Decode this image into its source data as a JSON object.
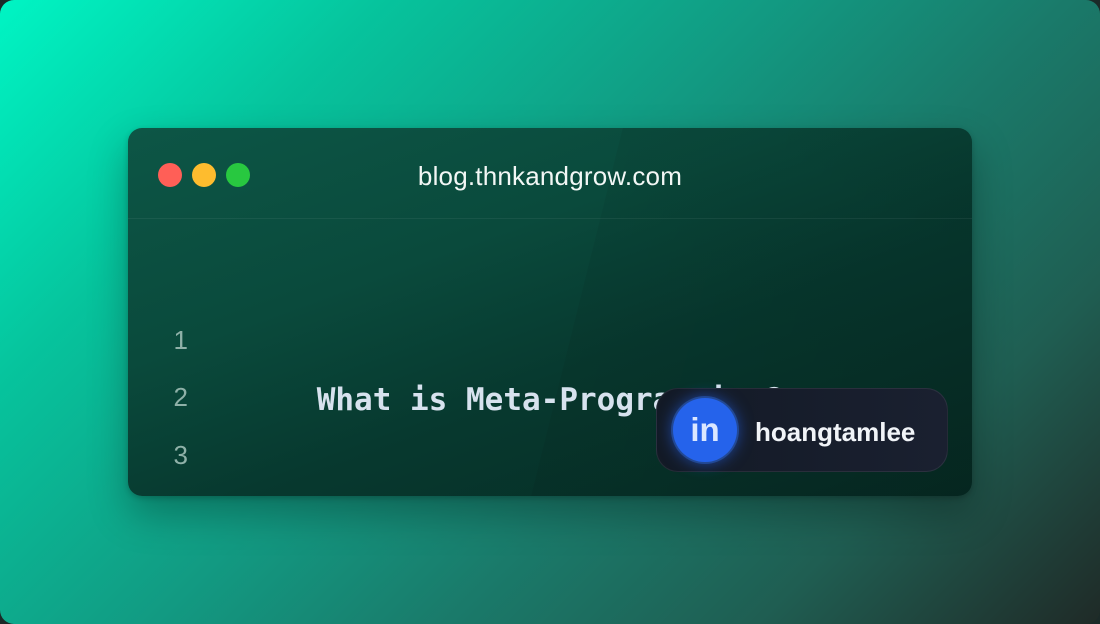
{
  "window": {
    "url": "blog.thnkandgrow.com",
    "controls": [
      "close",
      "minimize",
      "maximize"
    ]
  },
  "editor": {
    "line_numbers": [
      "1",
      "2",
      "3"
    ],
    "code_text": "What is Meta-Programming?"
  },
  "badge": {
    "logo_text": "in",
    "handle": "hoangtamlee"
  },
  "colors": {
    "close": "#ff5f57",
    "minimize": "#febc2e",
    "maximize": "#28c840",
    "linkedin": "#2563eb"
  },
  "icons": {
    "logo": "linkedin-icon"
  }
}
